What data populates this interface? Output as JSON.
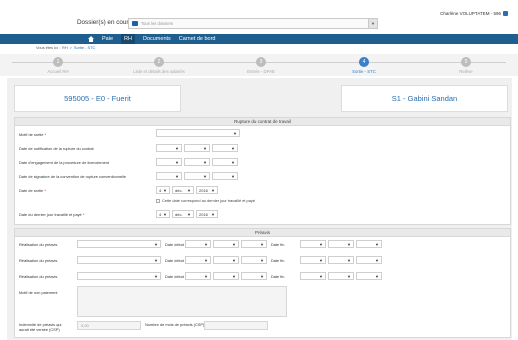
{
  "header": {
    "user": "Charlène VOLUPTATEM - 596",
    "dossier_label": "Dossier(s) en cours",
    "dossier_placeholder": "Tous les dossiers"
  },
  "nav": {
    "items": [
      {
        "label": "Paie"
      },
      {
        "label": "RH"
      },
      {
        "label": "Documents"
      },
      {
        "label": "Carnet de bord"
      }
    ]
  },
  "breadcrumb": {
    "prefix": "Vous êtes ici :",
    "level1": "RH",
    "separator": ">",
    "level2": "Sortie - STC"
  },
  "steps": [
    {
      "num": "1",
      "label": "Accueil RH"
    },
    {
      "num": "2",
      "label": "Liste et détails des salariés"
    },
    {
      "num": "3",
      "label": "Entrée - DPAE"
    },
    {
      "num": "4",
      "label": "Sortie - STC"
    },
    {
      "num": "5",
      "label": "Relève"
    }
  ],
  "employees": {
    "left": "595005 - E0 - Fuerit",
    "right": "S1 - Gabini Sandan"
  },
  "rupture": {
    "title": "Rupture du contrat de travail",
    "motif_label": "Motif de sortie",
    "notification_label": "Date de notification de la rupture du contrat",
    "engagement_label": "Date d'engagement de la procédure de licenciement",
    "signature_label": "Date de signature de la convention de rupture conventionnelle",
    "sortie_label": "Date de sortie",
    "dernier_label": "Date du dernier jour travaillé et payé",
    "day": "4",
    "month": "déc.",
    "year": "2016",
    "checkbox_label": "Cette date correspond au dernier jour travaillé et payé"
  },
  "preavis": {
    "title": "Préavis",
    "realisation_label": "Réalisation du préavis",
    "debut_label": "Date début",
    "fin_label": "Date fin",
    "motif_label": "Motif de non paiement",
    "indemnite_label": "Indemnité de préavis qui aurait été versée (CSP)",
    "indemnite_value": "0,00",
    "mois_label": "Nombre de mois de préavis (CSP)"
  },
  "colors": {
    "nav": "#1e5f8f",
    "accent": "#3b7fc4",
    "link": "#2a6fb0"
  }
}
